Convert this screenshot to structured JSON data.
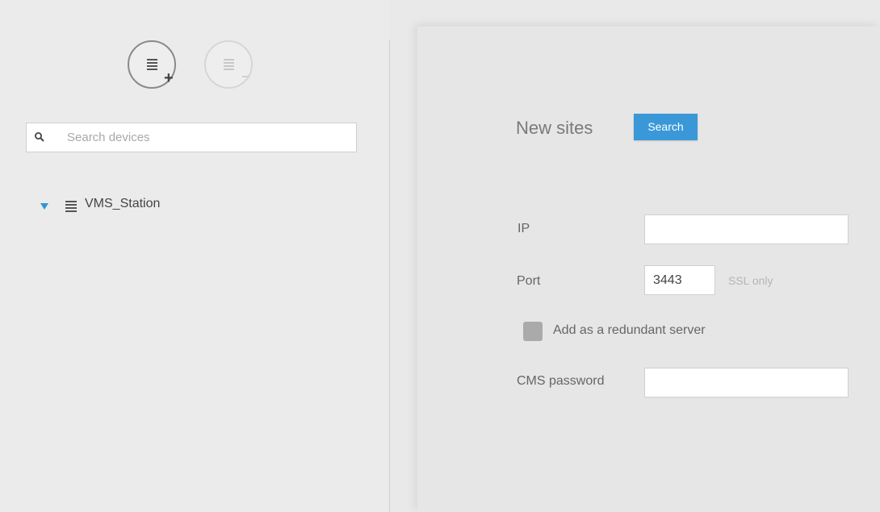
{
  "toolbar": {
    "add_icon": "server-add-icon",
    "remove_icon": "server-remove-icon",
    "add_badge": "+",
    "remove_badge": "−"
  },
  "search": {
    "placeholder": "Search devices",
    "value": "",
    "icon": "search-icon"
  },
  "tree": {
    "items": [
      {
        "label": "VMS_Station",
        "expanded": true,
        "icon": "server-icon"
      }
    ]
  },
  "form": {
    "title": "New sites",
    "search_button": "Search",
    "ip_label": "IP",
    "ip_value": "",
    "port_label": "Port",
    "port_value": "3443",
    "ssl_note": "SSL only",
    "redundant_label": "Add as a redundant server",
    "redundant_checked": false,
    "cms_password_label": "CMS password",
    "cms_password_value": ""
  },
  "colors": {
    "accent": "#3a98d8",
    "tree_arrow": "#2f96d6",
    "checkbox": "#aaaaaa"
  }
}
